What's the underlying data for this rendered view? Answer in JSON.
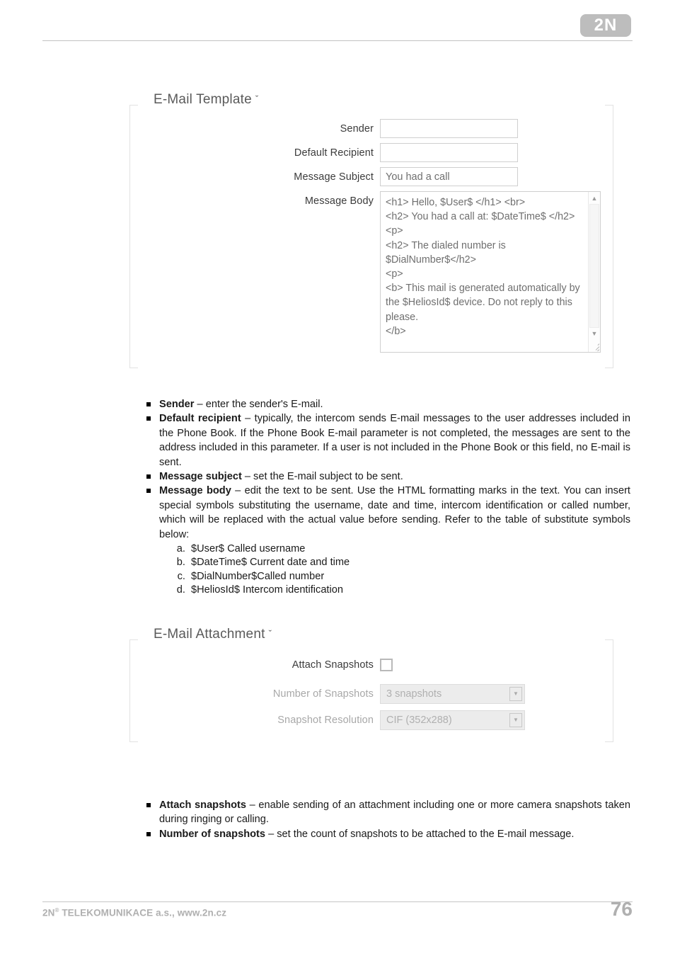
{
  "header": {
    "logo_text": "2N"
  },
  "template_panel": {
    "title": "E-Mail Template",
    "chevron": "ˇ",
    "fields": {
      "sender_label": "Sender",
      "sender_value": "",
      "recipient_label": "Default Recipient",
      "recipient_value": "",
      "subject_label": "Message Subject",
      "subject_value": "You had a call",
      "body_label": "Message Body",
      "body_value": "<h1> Hello, $User$ </h1> <br>\n<h2> You had a call at: $DateTime$ </h2>\n<p>\n<h2> The dialed number is $DialNumber$</h2>\n<p>\n<b> This mail is generated automatically by the $HeliosId$ device. Do not reply to this please.\n</b>",
      "scroll_up": "▲",
      "scroll_down": "▼"
    }
  },
  "template_notes": [
    {
      "term": "Sender",
      "text": " – enter the sender's E-mail."
    },
    {
      "term": "Default recipient",
      "text": " – typically, the intercom sends E-mail messages to the user addresses included in the Phone Book. If the Phone Book E-mail parameter is not completed, the messages are sent to the address included in this parameter. If a user is not included in the Phone Book or this field, no E-mail is sent."
    },
    {
      "term": "Message subject",
      "text": " – set the E-mail subject to be sent."
    },
    {
      "term": "Message body",
      "text": " – edit the text to be sent. Use the HTML formatting marks in the text. You can insert special symbols substituting the username, date and time, intercom identification or called number, which will be replaced with the actual value before sending. Refer to the table of substitute symbols below:"
    }
  ],
  "substitute_symbols": [
    "$User$ Called username",
    "$DateTime$ Current date and time",
    "$DialNumber$Called number",
    "$HeliosId$ Intercom identification"
  ],
  "attachment_panel": {
    "title": "E-Mail Attachment",
    "chevron": "ˇ",
    "fields": {
      "attach_label": "Attach Snapshots",
      "attach_checked": false,
      "count_label": "Number of Snapshots",
      "count_value": "3 snapshots",
      "resolution_label": "Snapshot Resolution",
      "resolution_value": "CIF (352x288)",
      "dropdown_glyph": "▼"
    }
  },
  "attachment_notes": [
    {
      "term": "Attach snapshots",
      "text": " – enable sending of an attachment including one or more camera snapshots taken during ringing or calling."
    },
    {
      "term": "Number of snapshots",
      "text": " – set the count of snapshots to be attached to the E-mail message."
    }
  ],
  "footer": {
    "company": "2N",
    "registered": "®",
    "company_rest": " TELEKOMUNIKACE a.s., www.2n.cz",
    "page_number": "76"
  }
}
